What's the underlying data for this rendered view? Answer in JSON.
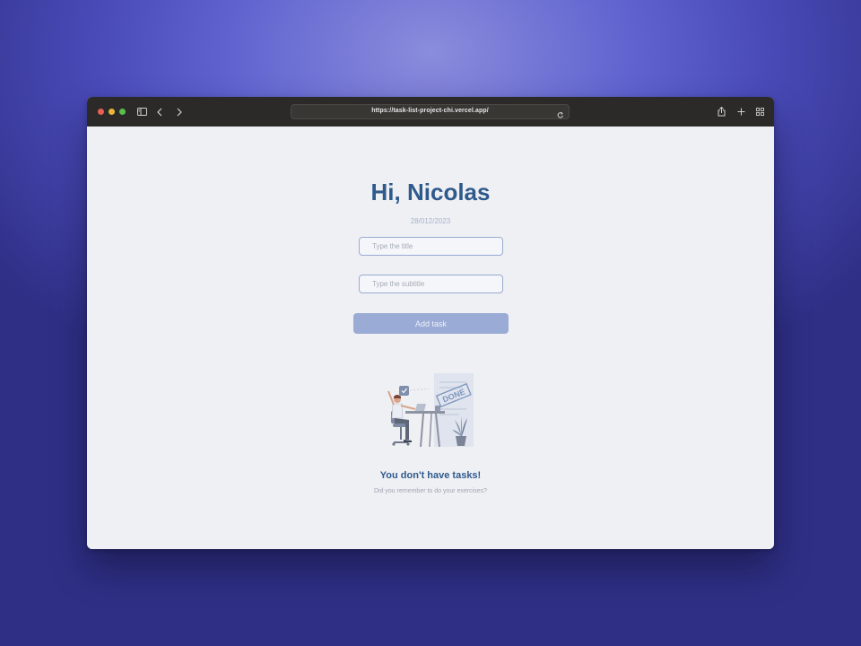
{
  "browser": {
    "url": "https://task-list-project-chi.vercel.app/",
    "icons": [
      "sidebar-icon",
      "back-icon",
      "forward-icon",
      "reload-icon",
      "share-icon",
      "new-tab-icon",
      "tab-overview-icon"
    ]
  },
  "page": {
    "greeting": "Hi, Nicolas",
    "date": "28/012/2023",
    "title_placeholder": "Type the title",
    "subtitle_placeholder": "Type the subtitle",
    "add_button_label": "Add task",
    "illustration_stamp": "DONE",
    "empty_title": "You don't have tasks!",
    "empty_subtitle": "Did you remember to do your exercises?"
  },
  "colors": {
    "accent": "#2f5a8c",
    "button": "#9aabd5",
    "background": "#eff0f4"
  }
}
